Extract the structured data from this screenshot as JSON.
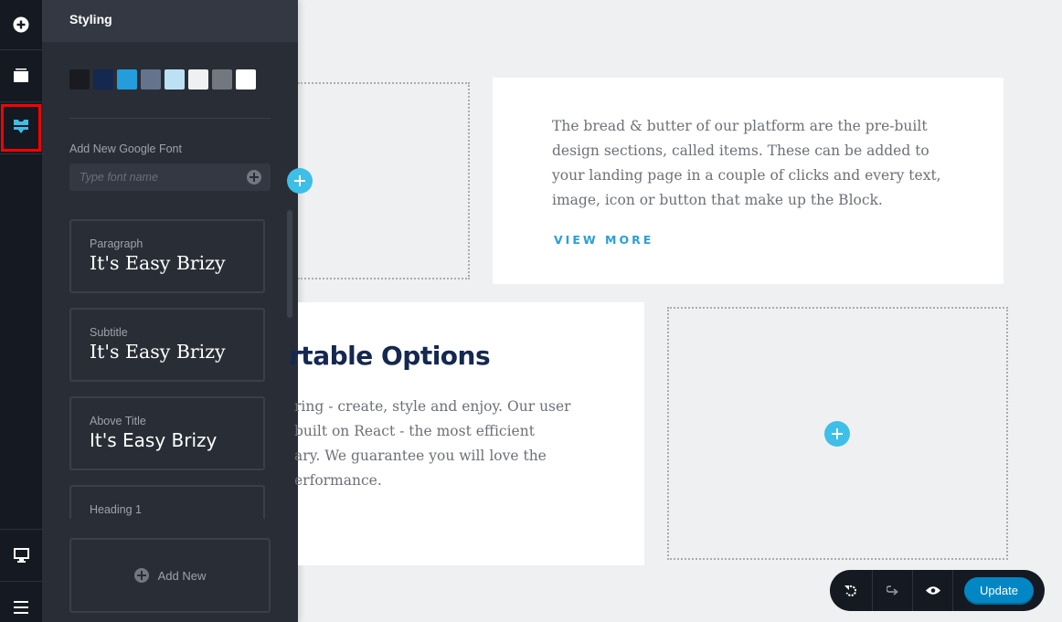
{
  "rail": {
    "items": [
      {
        "name": "add-elements",
        "icon": "plus-circle-icon",
        "active": false
      },
      {
        "name": "blocks",
        "icon": "layers-icon",
        "active": false
      },
      {
        "name": "styling",
        "icon": "paint-brush-icon",
        "active": true
      }
    ],
    "bottom_items": [
      {
        "name": "device-view",
        "icon": "monitor-icon"
      },
      {
        "name": "menu",
        "icon": "hamburger-icon"
      }
    ],
    "accent": "#3dbfe8",
    "highlight": "#ff0000"
  },
  "panel": {
    "title": "Styling",
    "palette": [
      "#191b21",
      "#142850",
      "#239ddb",
      "#66738d",
      "#bde1f4",
      "#eef0f2",
      "#73777f",
      "#ffffff"
    ],
    "google_font": {
      "label": "Add New Google Font",
      "placeholder": "Type font name",
      "value": ""
    },
    "font_styles": [
      {
        "label": "Paragraph",
        "sample": "It's Easy Brizy"
      },
      {
        "label": "Subtitle",
        "sample": "It's Easy Brizy"
      },
      {
        "label": "Above Title",
        "sample": "It's Easy Brizy"
      },
      {
        "label": "Heading 1",
        "sample": ""
      }
    ],
    "add_new_label": "Add New"
  },
  "canvas": {
    "card1": {
      "text": "The bread & butter of our platform are the pre-built design sections, called items. These can be added to your landing page in a couple of clicks and every text, image, icon or button that make up the Block.",
      "link": "VIEW MORE"
    },
    "card2": {
      "heading": "rtable Options",
      "lines": [
        "ring - create, style and enjoy. Our user",
        "built on React - the most efficient",
        "ary. We guarantee you will love the",
        "erformance."
      ]
    }
  },
  "toolbar": {
    "undo_icon": "undo-icon",
    "redo_icon": "redo-icon",
    "preview_icon": "eye-icon",
    "update_label": "Update"
  }
}
